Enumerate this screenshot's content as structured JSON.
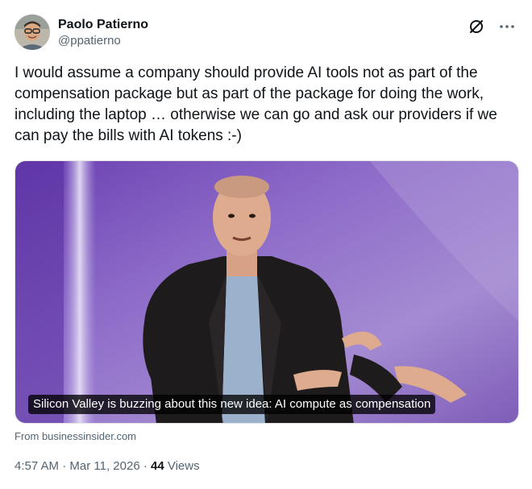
{
  "author": {
    "display_name": "Paolo Patierno",
    "handle": "@ppatierno"
  },
  "icons": {
    "x_logo": "x-logo-icon",
    "more": "more-options-icon"
  },
  "tweet": {
    "text": "I would assume a company should provide AI tools not as part of the\ncompensation package but as part of the package for doing the work,\nincluding the laptop … otherwise we can go and ask our providers if we\ncan pay the bills with AI tokens :-)"
  },
  "card": {
    "caption": "Silicon Valley is buzzing about this new idea: AI compute as compensation",
    "source": "From businessinsider.com"
  },
  "meta": {
    "time": "4:57 AM",
    "separator": " · ",
    "date": "Mar 11, 2026",
    "views_count": "44",
    "views_label": " Views"
  },
  "colors": {
    "text_primary": "#0f1419",
    "text_secondary": "#536471",
    "stage_purple": "#8a63c4"
  }
}
